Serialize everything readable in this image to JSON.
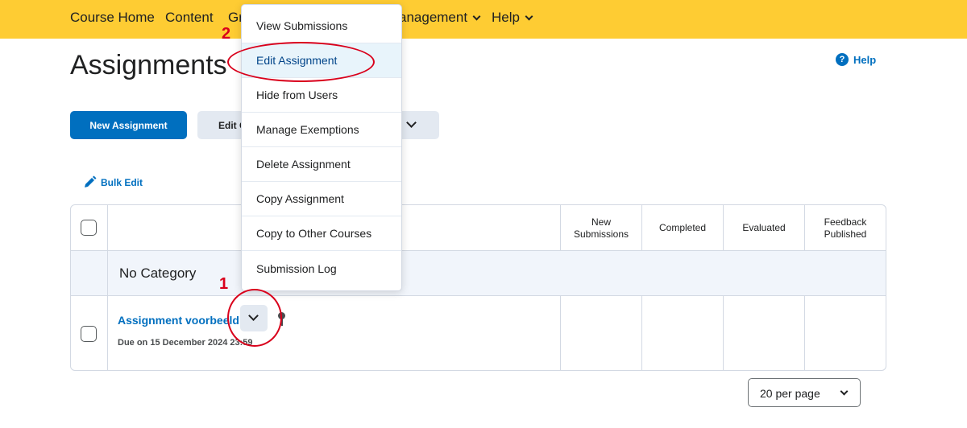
{
  "nav": {
    "items": [
      {
        "label": "Course Home",
        "dropdown": false
      },
      {
        "label": "Content",
        "dropdown": false
      },
      {
        "label": "Gr",
        "dropdown": false
      },
      {
        "label": "anagement",
        "dropdown": true
      },
      {
        "label": "Help",
        "dropdown": true
      }
    ]
  },
  "page": {
    "title": "Assignments",
    "help_label": "Help"
  },
  "toolbar": {
    "new_label": "New Assignment",
    "edit_label": "Edit C",
    "bulk_edit_label": "Bulk Edit"
  },
  "table": {
    "columns": [
      "New\nSubmissions",
      "Completed",
      "Evaluated",
      "Feedback\nPublished"
    ],
    "category": "No Category",
    "row": {
      "name": "Assignment voorbeeld",
      "due": "Due on 15 December 2024 23:59"
    }
  },
  "pagination": {
    "per_page": "20 per page"
  },
  "context_menu": {
    "items": [
      "View Submissions",
      "Edit Assignment",
      "Hide from Users",
      "Manage Exemptions",
      "Delete Assignment",
      "Copy Assignment",
      "Copy to Other Courses",
      "Submission Log"
    ],
    "highlighted": "Edit Assignment"
  },
  "annotations": {
    "step1": "1",
    "step2": "2",
    "color": "#d9001b"
  },
  "colors": {
    "topbar": "#fecc33",
    "primary": "#006fbf"
  }
}
